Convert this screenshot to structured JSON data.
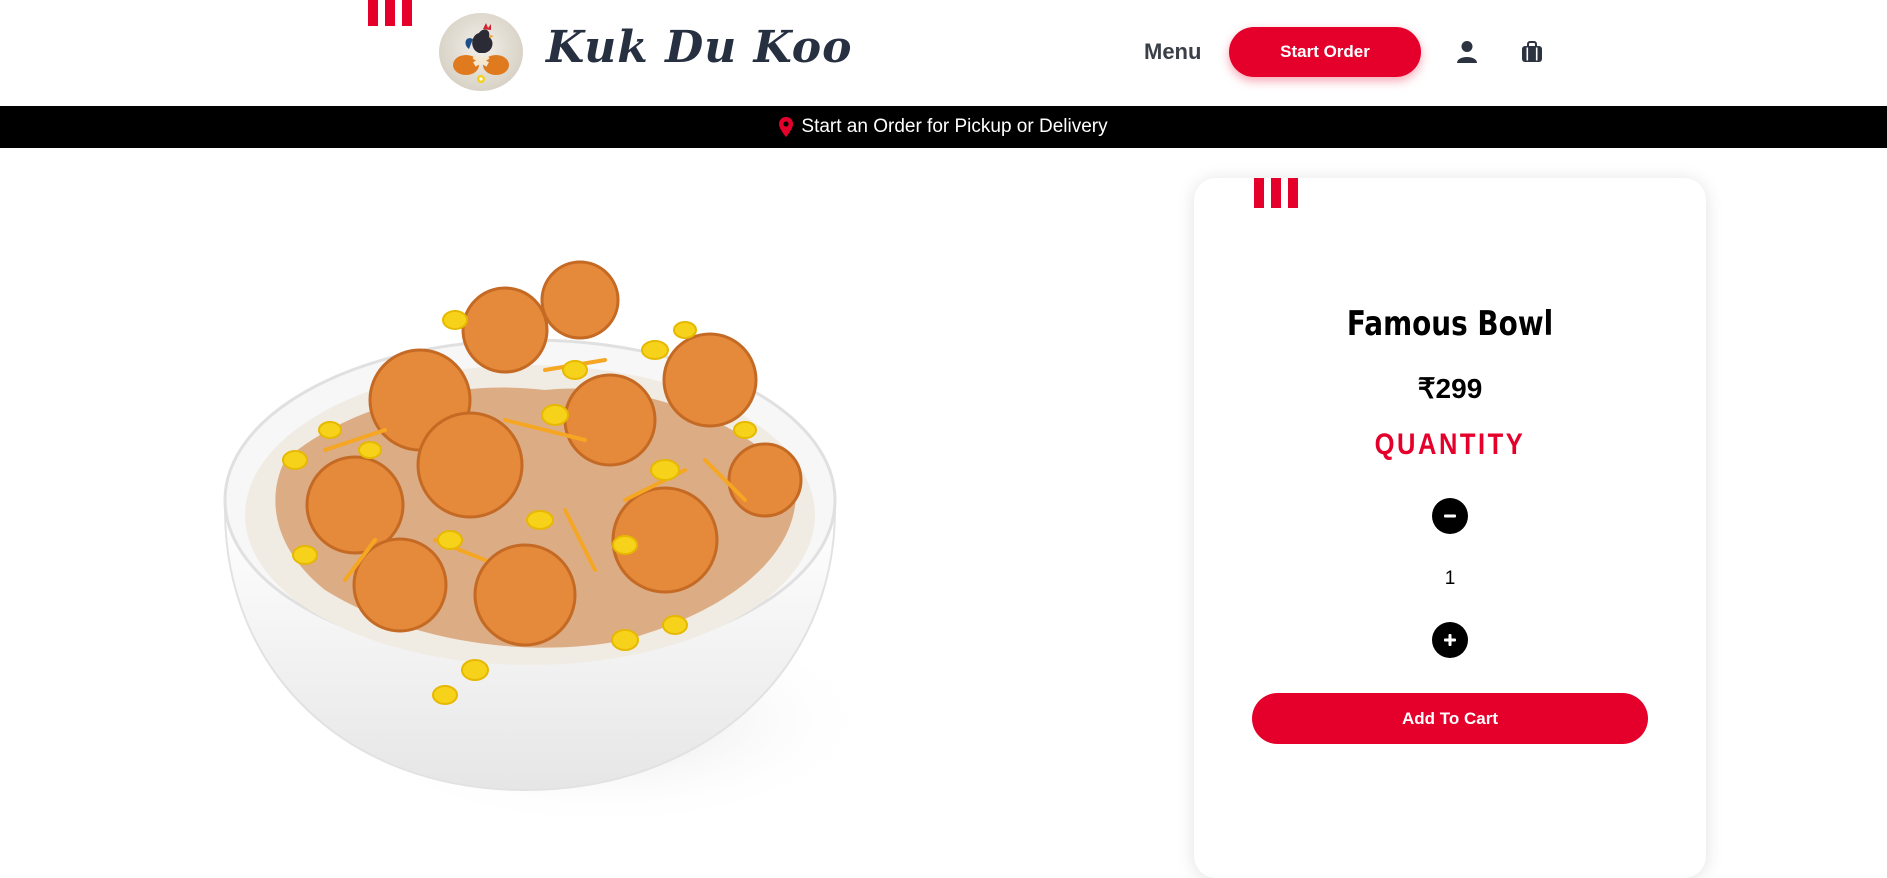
{
  "brand": {
    "name": "Kuk Du Koo",
    "logo": "rooster-chicken-logo"
  },
  "nav": {
    "menu_label": "Menu",
    "start_order_label": "Start Order",
    "user_icon": "user-icon",
    "bag_icon": "shopping-bag-icon"
  },
  "banner": {
    "icon": "location-pin-icon",
    "text": "Start an Order for Pickup or Delivery"
  },
  "product": {
    "image": "famous-bowl-photo",
    "name": "Famous Bowl",
    "price": "₹299",
    "quantity_label": "QUANTITY",
    "quantity": "1",
    "add_to_cart_label": "Add To Cart"
  },
  "colors": {
    "accent": "#e4002b",
    "banner_bg": "#000000",
    "brand_text": "#263040"
  }
}
